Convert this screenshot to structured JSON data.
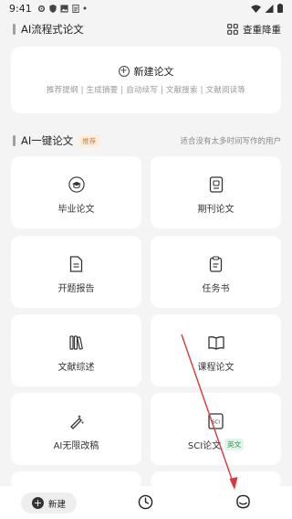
{
  "status_bar": {
    "time": "9:41"
  },
  "flow_section": {
    "title": "AI流程式论文",
    "right_action": "查重降重",
    "right_icon": "grid-icon"
  },
  "new_paper": {
    "label": "新建论文",
    "subtitle": "推荐提纲 | 生成摘要 | 自动续写 | 文献搜索 | 文献阅读等"
  },
  "one_click_section": {
    "title": "AI一键论文",
    "badge": "推荐",
    "hint": "适合没有太多时间写作的用户"
  },
  "cards": [
    {
      "label": "毕业论文",
      "icon": "graduation-cap-icon"
    },
    {
      "label": "期刊论文",
      "icon": "journal-icon"
    },
    {
      "label": "开题报告",
      "icon": "document-icon"
    },
    {
      "label": "任务书",
      "icon": "clipboard-icon"
    },
    {
      "label": "文献综述",
      "icon": "books-icon"
    },
    {
      "label": "课程论文",
      "icon": "open-book-icon"
    },
    {
      "label": "AI无限改稿",
      "icon": "magic-pen-icon"
    },
    {
      "label": "SCI论文",
      "icon": "sci-icon",
      "badge": "英文"
    }
  ],
  "bottom_nav": {
    "new_label": "新建",
    "history_icon": "clock-icon",
    "profile_icon": "robot-icon"
  },
  "colors": {
    "background": "#f4f4f4",
    "card": "#ffffff",
    "recommend_badge": "#e27a2a",
    "english_badge": "#2a9d5a",
    "annotation_arrow": "#d9363e"
  }
}
